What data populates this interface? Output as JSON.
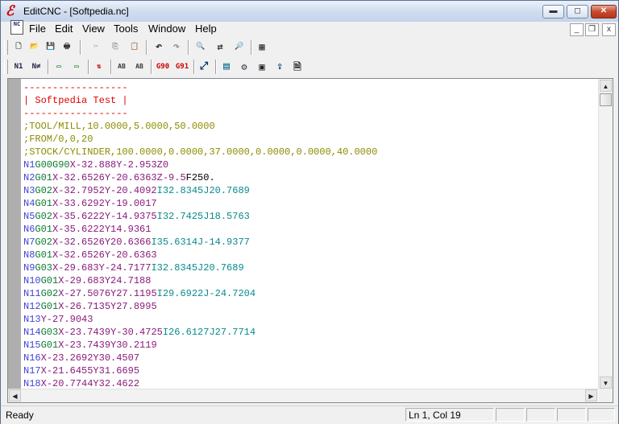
{
  "window": {
    "app_icon_glyph": "ℰ",
    "title": "EditCNC - [Softpedia.nc]",
    "controls": {
      "minimize": "▬",
      "maximize": "◻",
      "close": "✕"
    }
  },
  "menubar": {
    "doc_icon": "NC",
    "items": [
      "File",
      "Edit",
      "View",
      "Tools",
      "Window",
      "Help"
    ],
    "mdi_controls": {
      "minimize": "_",
      "restore": "❐",
      "close": "x"
    }
  },
  "toolbar1": {
    "buttons": [
      {
        "name": "new-file-icon",
        "glyph": "🗋"
      },
      {
        "name": "open-folder-icon",
        "glyph": "📂"
      },
      {
        "name": "save-icon",
        "glyph": "💾"
      },
      {
        "name": "print-icon",
        "glyph": "🖶"
      },
      {
        "name": "cut-icon",
        "glyph": "✂"
      },
      {
        "name": "copy-icon",
        "glyph": "⎘"
      },
      {
        "name": "paste-icon",
        "glyph": "📋"
      },
      {
        "name": "undo-icon",
        "glyph": "↶"
      },
      {
        "name": "redo-icon",
        "glyph": "↷"
      },
      {
        "name": "find-icon",
        "glyph": "🔍"
      },
      {
        "name": "replace-icon",
        "glyph": "⇄"
      },
      {
        "name": "find-next-icon",
        "glyph": "🔎"
      },
      {
        "name": "calculator-grid-icon",
        "glyph": "▦"
      }
    ]
  },
  "toolbar2": {
    "buttons": [
      {
        "name": "renumber-icon",
        "glyph": "N1"
      },
      {
        "name": "remove-numbers-icon",
        "glyph": "N≠"
      },
      {
        "name": "insert-spaces-icon",
        "glyph": "▭"
      },
      {
        "name": "remove-spaces-icon",
        "glyph": "▭"
      },
      {
        "name": "sort-icon",
        "glyph": "⇅"
      },
      {
        "name": "ab-format-icon",
        "glyph": "AB"
      },
      {
        "name": "ab-convert-icon",
        "glyph": "AB"
      },
      {
        "name": "g90-icon",
        "glyph": "G90"
      },
      {
        "name": "g91-icon",
        "glyph": "G91"
      },
      {
        "name": "scale-icon",
        "glyph": "⤢"
      },
      {
        "name": "calculator-icon",
        "glyph": "▤"
      },
      {
        "name": "machine-icon",
        "glyph": "⚙"
      },
      {
        "name": "dnc-icon",
        "glyph": "▣"
      },
      {
        "name": "transmit-icon",
        "glyph": "⇪"
      },
      {
        "name": "backplot-icon",
        "glyph": "🗎"
      }
    ]
  },
  "editor": {
    "lines": [
      [
        {
          "t": "------------------",
          "c": "hdr"
        }
      ],
      [
        {
          "t": "| Softpedia Test |",
          "c": "hdr"
        }
      ],
      [
        {
          "t": "------------------",
          "c": "hdr"
        }
      ],
      [
        {
          "t": ";TOOL/MILL,10.0000,5.0000,50.0000",
          "c": "com"
        }
      ],
      [
        {
          "t": ";FROM/0,0,20",
          "c": "com"
        }
      ],
      [
        {
          "t": ";STOCK/CYLINDER,100.0000,0.0000,37.0000,0.0000,0.0000,40.0000",
          "c": "com"
        }
      ],
      [
        {
          "t": "N1",
          "c": "n"
        },
        {
          "t": "G00G90",
          "c": "g"
        },
        {
          "t": "X-32.888Y-2.953Z0",
          "c": "xy"
        }
      ],
      [
        {
          "t": "N2",
          "c": "n"
        },
        {
          "t": "G01",
          "c": "g"
        },
        {
          "t": "X-32.6526Y-20.6363Z-9.5",
          "c": "xy"
        },
        {
          "t": "F250.",
          "c": "f"
        }
      ],
      [
        {
          "t": "N3",
          "c": "n"
        },
        {
          "t": "G02",
          "c": "g"
        },
        {
          "t": "X-32.7952Y-20.4092",
          "c": "xy"
        },
        {
          "t": "I32.8345J20.7689",
          "c": "ij"
        }
      ],
      [
        {
          "t": "N4",
          "c": "n"
        },
        {
          "t": "G01",
          "c": "g"
        },
        {
          "t": "X-33.6292Y-19.0017",
          "c": "xy"
        }
      ],
      [
        {
          "t": "N5",
          "c": "n"
        },
        {
          "t": "G02",
          "c": "g"
        },
        {
          "t": "X-35.6222Y-14.9375",
          "c": "xy"
        },
        {
          "t": "I32.7425J18.5763",
          "c": "ij"
        }
      ],
      [
        {
          "t": "N6",
          "c": "n"
        },
        {
          "t": "G01",
          "c": "g"
        },
        {
          "t": "X-35.6222Y14.9361",
          "c": "xy"
        }
      ],
      [
        {
          "t": "N7",
          "c": "n"
        },
        {
          "t": "G02",
          "c": "g"
        },
        {
          "t": "X-32.6526Y20.6366",
          "c": "xy"
        },
        {
          "t": "I35.6314J-14.9377",
          "c": "ij"
        }
      ],
      [
        {
          "t": "N8",
          "c": "n"
        },
        {
          "t": "G01",
          "c": "g"
        },
        {
          "t": "X-32.6526Y-20.6363",
          "c": "xy"
        }
      ],
      [
        {
          "t": "N9",
          "c": "n"
        },
        {
          "t": "G03",
          "c": "g"
        },
        {
          "t": "X-29.683Y-24.7177",
          "c": "xy"
        },
        {
          "t": "I32.8345J20.7689",
          "c": "ij"
        }
      ],
      [
        {
          "t": "N10",
          "c": "n"
        },
        {
          "t": "G01",
          "c": "g"
        },
        {
          "t": "X-29.683Y24.7188",
          "c": "xy"
        }
      ],
      [
        {
          "t": "N11",
          "c": "n"
        },
        {
          "t": "G02",
          "c": "g"
        },
        {
          "t": "X-27.5076Y27.1195",
          "c": "xy"
        },
        {
          "t": "I29.6922J-24.7204",
          "c": "ij"
        }
      ],
      [
        {
          "t": "N12",
          "c": "n"
        },
        {
          "t": "G01",
          "c": "g"
        },
        {
          "t": "X-26.7135Y27.8995",
          "c": "xy"
        }
      ],
      [
        {
          "t": "N13",
          "c": "n"
        },
        {
          "t": "Y-27.9043",
          "c": "xy"
        }
      ],
      [
        {
          "t": "N14",
          "c": "n"
        },
        {
          "t": "G03",
          "c": "g"
        },
        {
          "t": "X-23.7439Y-30.4725",
          "c": "xy"
        },
        {
          "t": "I26.6127J27.7714",
          "c": "ij"
        }
      ],
      [
        {
          "t": "N15",
          "c": "n"
        },
        {
          "t": "G01",
          "c": "g"
        },
        {
          "t": "X-23.7439Y30.2119",
          "c": "xy"
        }
      ],
      [
        {
          "t": "N16",
          "c": "n"
        },
        {
          "t": "X-23.2692Y30.4507",
          "c": "xy"
        }
      ],
      [
        {
          "t": "N17",
          "c": "n"
        },
        {
          "t": "X-21.6455Y31.6695",
          "c": "xy"
        }
      ],
      [
        {
          "t": "N18",
          "c": "n"
        },
        {
          "t": "X-20.7744Y32.4622",
          "c": "xy"
        }
      ]
    ]
  },
  "scrollbars": {
    "up": "▲",
    "down": "▼",
    "left": "◀",
    "right": "▶"
  },
  "statusbar": {
    "status": "Ready",
    "position": "Ln 1, Col 19"
  }
}
